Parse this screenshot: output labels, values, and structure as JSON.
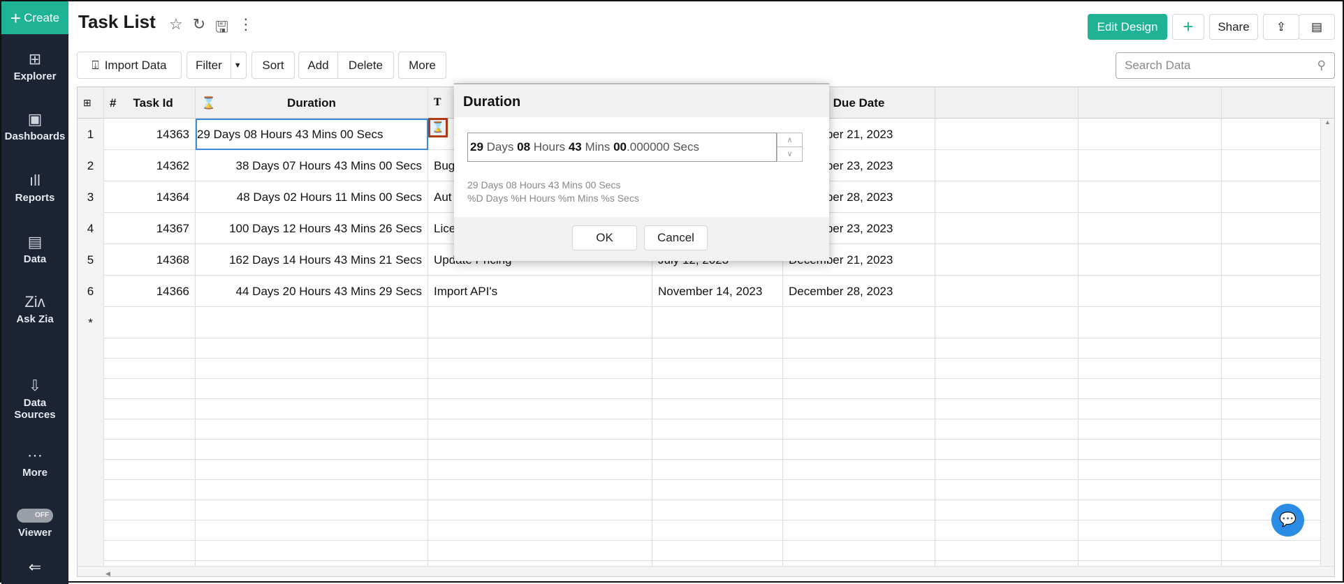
{
  "sidebar": {
    "create": "Create",
    "items": [
      {
        "label": "Explorer",
        "icon": "explorer-icon"
      },
      {
        "label": "Dashboards",
        "icon": "dashboards-icon"
      },
      {
        "label": "Reports",
        "icon": "reports-icon"
      },
      {
        "label": "Data",
        "icon": "data-icon"
      },
      {
        "label": "Ask Zia",
        "icon": "zia-icon"
      },
      {
        "label": "Data",
        "label2": "Sources",
        "icon": "data-sources-icon"
      },
      {
        "label": "More",
        "icon": "more-icon"
      },
      {
        "label": "Viewer",
        "toggle": "OFF"
      }
    ]
  },
  "header": {
    "title": "Task List",
    "edit_design": "Edit Design",
    "share": "Share"
  },
  "toolbar": {
    "import": "Import Data",
    "filter": "Filter",
    "sort": "Sort",
    "add": "Add",
    "delete": "Delete",
    "more": "More",
    "search_placeholder": "Search Data"
  },
  "table": {
    "columns": [
      "#",
      "Task Id",
      "Duration",
      "",
      "",
      "Due Date"
    ],
    "rows": [
      {
        "n": "1",
        "id": "14363",
        "duration": "29 Days 08 Hours 43 Mins 00 Secs",
        "task": "",
        "start": "",
        "due": "December 21, 2023"
      },
      {
        "n": "2",
        "id": "14362",
        "duration": "38 Days 07 Hours 43 Mins 00 Secs",
        "task": "Bug",
        "start": "",
        "due": "December 23, 2023"
      },
      {
        "n": "3",
        "id": "14364",
        "duration": "48 Days 02 Hours 11 Mins 00 Secs",
        "task": "Aut",
        "start": "",
        "due": "December 28, 2023"
      },
      {
        "n": "4",
        "id": "14367",
        "duration": "100 Days 12 Hours 43 Mins 26 Secs",
        "task": "Lice",
        "start": "",
        "due": "December 23, 2023"
      },
      {
        "n": "5",
        "id": "14368",
        "duration": "162 Days 14 Hours 43 Mins 21 Secs",
        "task": "Update Pricing",
        "start": "July 12, 2023",
        "due": "December 21, 2023"
      },
      {
        "n": "6",
        "id": "14366",
        "duration": "44 Days 20 Hours 43 Mins 29 Secs",
        "task": "Import API's",
        "start": "November 14, 2023",
        "due": "December 28, 2023"
      }
    ],
    "new_row": "*"
  },
  "modal": {
    "title": "Duration",
    "value": {
      "d": "29",
      "days": " Days ",
      "h": "08",
      "hours": " Hours ",
      "m": "43",
      "mins": " Mins ",
      "s": "00",
      "secs": ".000000 Secs"
    },
    "preview": "29 Days 08 Hours 43 Mins 00 Secs",
    "format": "%D Days %H Hours %m Mins %s Secs",
    "ok": "OK",
    "cancel": "Cancel"
  },
  "colors": {
    "accent": "#1db394",
    "sidebar": "#1c2333",
    "selection": "#3b8bd8"
  }
}
